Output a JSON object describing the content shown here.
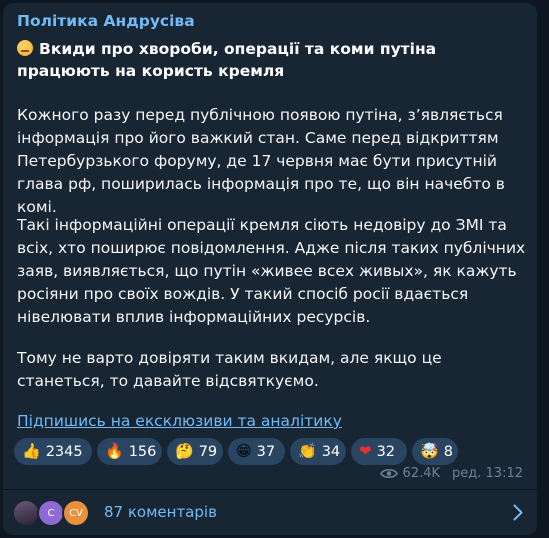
{
  "post": {
    "channel_name": "Політика Андрусіва",
    "headline": "Вкиди про хвороби, операції та коми путіна працюють на користь кремля",
    "paragraphs": [
      "Кожного разу перед публічною появою путіна, з’являється інформація про його важкий стан. Саме перед відкриттям Петербурзького форуму, де 17 червня має бути присутній глава рф, поширилась інформація про те, що він начебто в комі.",
      "Такі інформаційні операції кремля сіють недовіру до ЗМІ та всіх, хто поширює повідомлення. Адже після таких публічних заяв, виявляється, що путін «живее всех живых», як кажуть росіяни про своїх вождів. У такий спосіб росії вдається нівелювати вплив інформаційних ресурсів.",
      "Тому не варто довіряти таким вкидам, але якщо це станеться, то давайте відсвяткуємо."
    ],
    "subscribe_link": "Підпишись на ексклюзиви та аналітику"
  },
  "reactions": [
    {
      "emoji": "👍",
      "icon": "thumbs-up-icon",
      "count": "2345"
    },
    {
      "emoji": "🔥",
      "icon": "fire-icon",
      "count": "156"
    },
    {
      "emoji": "🤔",
      "icon": "thinking-face-icon",
      "count": "79"
    },
    {
      "emoji": "😁",
      "icon": "grinning-face-icon",
      "count": "37"
    },
    {
      "emoji": "👏",
      "icon": "clapping-hands-icon",
      "count": "34"
    },
    {
      "emoji": "❤",
      "icon": "red-heart-icon",
      "count": "32"
    },
    {
      "emoji": "🤯",
      "icon": "exploding-head-icon",
      "count": "8"
    }
  ],
  "meta": {
    "views": "62.4K",
    "edited_time": "ред. 13:12"
  },
  "comments": {
    "avatars": [
      "",
      "C",
      "CV"
    ],
    "label": "87 коментарів"
  },
  "colors": {
    "background": "#0e1621",
    "bubble": "#182533",
    "accent": "#71baf5",
    "text": "#f5f5f5",
    "muted": "#6d8196"
  }
}
